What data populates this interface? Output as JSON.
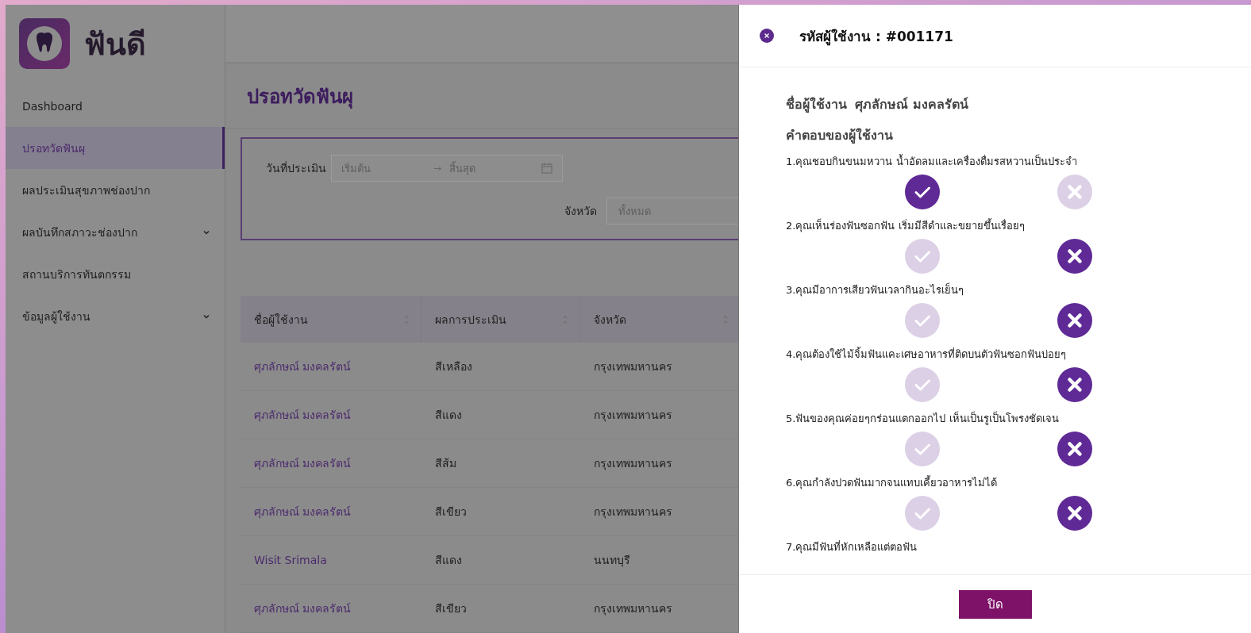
{
  "sidebar": {
    "logo_text": "ฟันดี",
    "items": [
      {
        "label": "Dashboard",
        "selected": false,
        "expandable": false
      },
      {
        "label": "ปรอทวัดฟันผุ",
        "selected": true,
        "expandable": false
      },
      {
        "label": "ผลประเมินสุขภาพช่องปาก",
        "selected": false,
        "expandable": false
      },
      {
        "label": "ผลบันทึกสภาวะช่องปาก",
        "selected": false,
        "expandable": true
      },
      {
        "label": "สถานบริการทันตกรรม",
        "selected": false,
        "expandable": false
      },
      {
        "label": "ข้อมูลผู้ใช้งาน",
        "selected": false,
        "expandable": true
      }
    ]
  },
  "page": {
    "title": "ปรอทวัดฟันผุ"
  },
  "filters": {
    "date": {
      "label": "วันที่ประเมิน",
      "start_placeholder": "เริ่มต้น",
      "separator": "→",
      "end_placeholder": "สิ้นสุด"
    },
    "province": {
      "label": "จังหวัด",
      "placeholder": "ทั้งหมด"
    }
  },
  "table": {
    "columns": [
      "ชื่อผู้ใช้งาน",
      "ผลการประเมิน",
      "จังหวัด"
    ],
    "rows": [
      [
        "ศุภลักษณ์ มงคลรัตน์",
        "สีเหลือง",
        "กรุงเทพมหานคร"
      ],
      [
        "ศุภลักษณ์ มงคลรัตน์",
        "สีแดง",
        "กรุงเทพมหานคร"
      ],
      [
        "ศุภลักษณ์ มงคลรัตน์",
        "สีส้ม",
        "กรุงเทพมหานคร"
      ],
      [
        "ศุภลักษณ์ มงคลรัตน์",
        "สีเขียว",
        "กรุงเทพมหานคร"
      ],
      [
        "Wisit Srimala",
        "สีแดง",
        "นนทบุรี"
      ],
      [
        "ศุภลักษณ์ มงคลรัตน์",
        "สีเขียว",
        "กรุงเทพมหานคร"
      ]
    ]
  },
  "drawer": {
    "title": "รหัสผู้ใช้งาน : #001171",
    "user_label": "ชื่อผู้ใช้งาน",
    "user_name": "ศุภลักษณ์ มงคลรัตน์",
    "answers_heading": "คำตอบของผู้ใช้งาน",
    "questions": [
      {
        "text": "1.คุณชอบกินขนมหวาน น้ำอัดลมและเครื่องดื่มรสหวานเป็นประจำ",
        "options": [
          {
            "kind": "check",
            "selected": true
          },
          {
            "kind": "cross",
            "selected": false
          }
        ]
      },
      {
        "text": "2.คุณเห็นร่องฟันซอกฟัน เริ่มมีสีดำและขยายขึ้นเรื่อยๆ",
        "options": [
          {
            "kind": "check",
            "selected": false
          },
          {
            "kind": "cross",
            "selected": true
          }
        ]
      },
      {
        "text": "3.คุณมีอาการเสียวฟันเวลากินอะไรเย็นๆ",
        "options": [
          {
            "kind": "check",
            "selected": false
          },
          {
            "kind": "cross",
            "selected": true
          }
        ]
      },
      {
        "text": "4.คุณต้องใช้ไม้จิ้มฟันแคะเศษอาหารที่ติดบนตัวฟันซอกฟันบ่อยๆ",
        "options": [
          {
            "kind": "check",
            "selected": false
          },
          {
            "kind": "cross",
            "selected": true
          }
        ]
      },
      {
        "text": "5.ฟันของคุณค่อยๆกร่อนแตกออกไป เห็นเป็นรูเป็นโพรงชัดเจน",
        "options": [
          {
            "kind": "check",
            "selected": false
          },
          {
            "kind": "cross",
            "selected": true
          }
        ]
      },
      {
        "text": "6.คุณกำลังปวดฟันมากจนแทบเคี้ยวอาหารไม่ได้",
        "options": [
          {
            "kind": "check",
            "selected": false
          },
          {
            "kind": "cross",
            "selected": true
          }
        ]
      },
      {
        "text": "7.คุณมีฟันที่หักเหลือแต่ตอฟัน"
      }
    ],
    "close_button": "ปิด"
  }
}
